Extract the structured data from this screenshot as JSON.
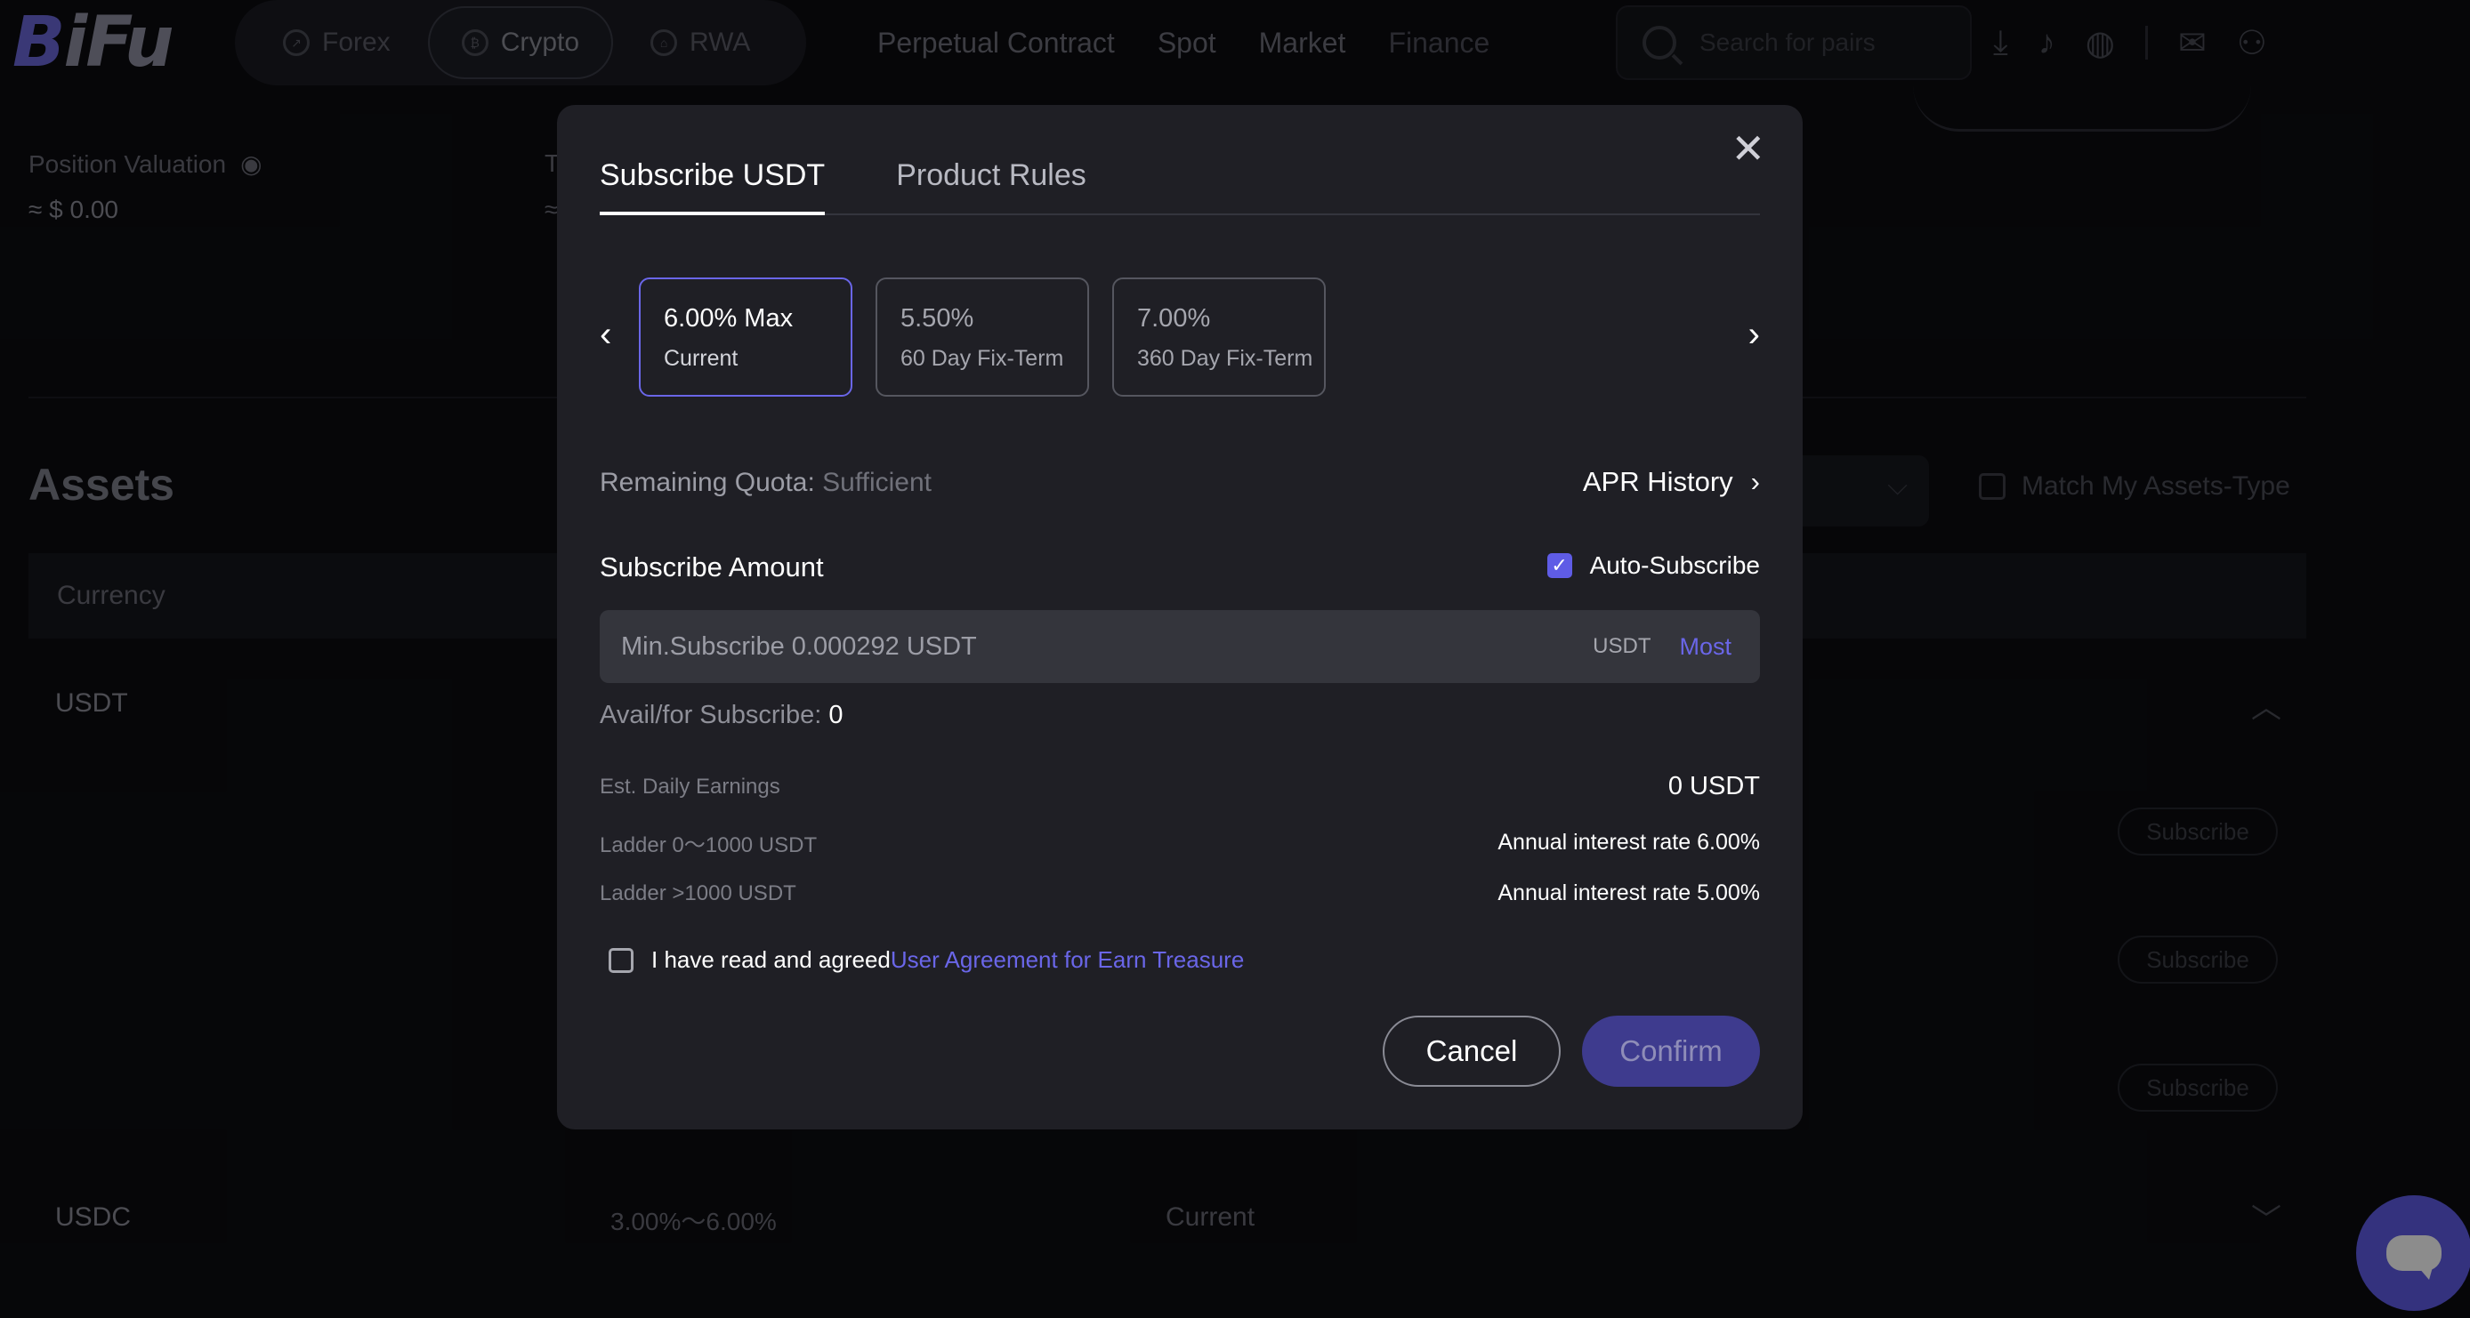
{
  "header": {
    "logo": "BiFu",
    "segments": [
      {
        "label": "Forex",
        "icon": "trend-icon"
      },
      {
        "label": "Crypto",
        "icon": "bitcoin-icon",
        "active": true
      },
      {
        "label": "RWA",
        "icon": "home-icon"
      }
    ],
    "nav": [
      "Perpetual Contract",
      "Spot",
      "Market",
      "Finance"
    ],
    "search_placeholder": "Search for pairs",
    "icons": [
      "download-icon",
      "bell-icon",
      "globe-icon",
      "mail-icon",
      "user-icon"
    ]
  },
  "background": {
    "position_valuation_label": "Position Valuation",
    "position_valuation_value": "≈ $ 0.00",
    "second_metric_label": "T",
    "second_metric_value": "≈",
    "assets_title": "Assets",
    "match_assets_label": "Match My Assets-Type",
    "table_header_currency": "Currency",
    "rows": [
      {
        "currency": "USDT"
      },
      {
        "currency": "USDC",
        "apr": "3.00%～6.00%",
        "term": "Current"
      }
    ],
    "subscribe_button_label": "Subscribe"
  },
  "modal": {
    "tabs": [
      "Subscribe USDT",
      "Product Rules"
    ],
    "options": [
      {
        "rate": "6.00% Max",
        "label": "Current",
        "active": true
      },
      {
        "rate": "5.50%",
        "label": "60 Day Fix-Term"
      },
      {
        "rate": "7.00%",
        "label": "360 Day Fix-Term"
      }
    ],
    "remaining_quota_label": "Remaining Quota:",
    "remaining_quota_value": "Sufficient",
    "apr_history_label": "APR History",
    "subscribe_amount_label": "Subscribe Amount",
    "auto_subscribe_label": "Auto-Subscribe",
    "auto_subscribe_checked": true,
    "amount_placeholder": "Min.Subscribe 0.000292 USDT",
    "amount_value": "",
    "unit": "USDT",
    "most_label": "Most",
    "avail_label": "Avail/for Subscribe:",
    "avail_value": "0",
    "est_daily_label": "Est. Daily Earnings",
    "est_daily_value": "0 USDT",
    "ladder1_label": "Ladder 0～1000 USDT",
    "ladder1_value": "Annual interest rate 6.00%",
    "ladder2_label": "Ladder >1000 USDT",
    "ladder2_value": "Annual interest rate 5.00%",
    "agree_text": "I have read and agreed",
    "agree_link": "User Agreement for Earn Treasure",
    "cancel_label": "Cancel",
    "confirm_label": "Confirm"
  },
  "colors": {
    "accent": "#5f5ce6",
    "modal_bg": "#1f1f25",
    "page_bg": "#0b0c10"
  }
}
